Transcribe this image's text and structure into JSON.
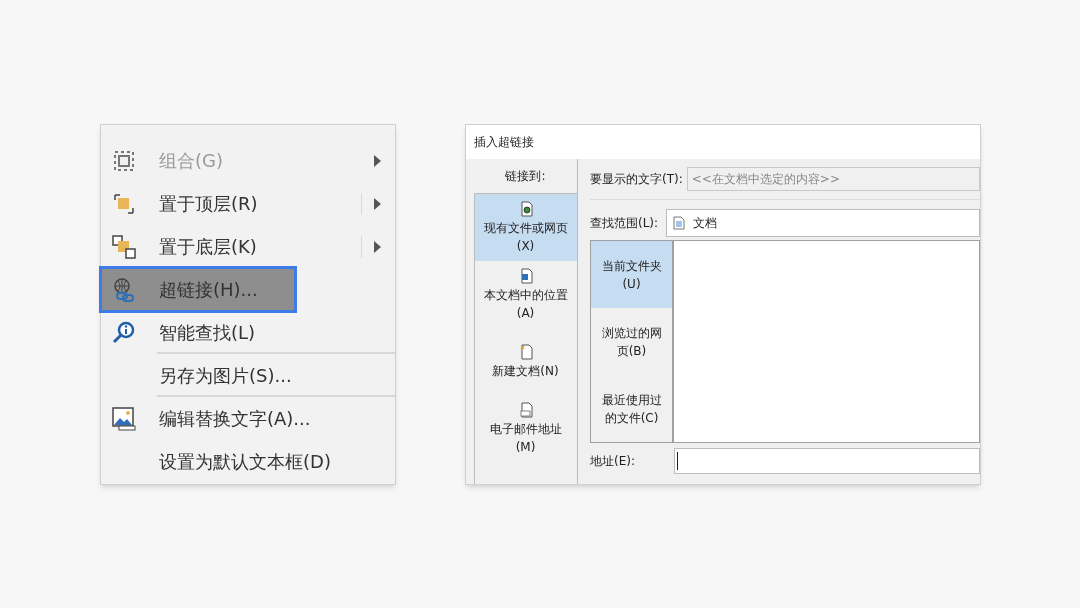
{
  "context_menu": {
    "items": [
      {
        "label": "组合(G)",
        "kind": "group",
        "disabled": true,
        "submenu": true,
        "split": false,
        "selected": false,
        "divider_after": false
      },
      {
        "label": "置于顶层(R)",
        "kind": "front",
        "disabled": false,
        "submenu": true,
        "split": true,
        "selected": false,
        "divider_after": false
      },
      {
        "label": "置于底层(K)",
        "kind": "back",
        "disabled": false,
        "submenu": true,
        "split": true,
        "selected": false,
        "divider_after": false
      },
      {
        "label": "超链接(H)...",
        "kind": "link",
        "disabled": false,
        "submenu": false,
        "split": false,
        "selected": true,
        "divider_after": false
      },
      {
        "label": "智能查找(L)",
        "kind": "search",
        "disabled": false,
        "submenu": false,
        "split": false,
        "selected": false,
        "divider_after": true
      },
      {
        "label": "另存为图片(S)...",
        "kind": "plain",
        "disabled": false,
        "submenu": false,
        "split": false,
        "selected": false,
        "divider_after": true
      },
      {
        "label": "编辑替换文字(A)...",
        "kind": "picture",
        "disabled": false,
        "submenu": false,
        "split": false,
        "selected": false,
        "divider_after": false
      },
      {
        "label": "设置为默认文本框(D)",
        "kind": "plain",
        "disabled": false,
        "submenu": false,
        "split": false,
        "selected": false,
        "divider_after": false
      }
    ]
  },
  "dialog": {
    "title": "插入超链接",
    "link_to_label": "链接到:",
    "link_to_items": [
      {
        "label": "现有文件或网页(X)",
        "kind": "file",
        "selected": true
      },
      {
        "label": "本文档中的位置(A)",
        "kind": "place",
        "selected": false
      },
      {
        "label": "新建文档(N)",
        "kind": "new",
        "selected": false
      },
      {
        "label": "电子邮件地址(M)",
        "kind": "mail",
        "selected": false
      }
    ],
    "display_text": {
      "label": "要显示的文字(T):",
      "value": "<<在文档中选定的内容>>"
    },
    "look_in": {
      "label": "查找范围(L):",
      "value": "文档"
    },
    "browse_tabs": [
      {
        "label": "当前文件夹(U)",
        "selected": true
      },
      {
        "label": "浏览过的网页(B)",
        "selected": false
      },
      {
        "label": "最近使用过的文件(C)",
        "selected": false
      }
    ],
    "address": {
      "label": "地址(E):"
    }
  }
}
